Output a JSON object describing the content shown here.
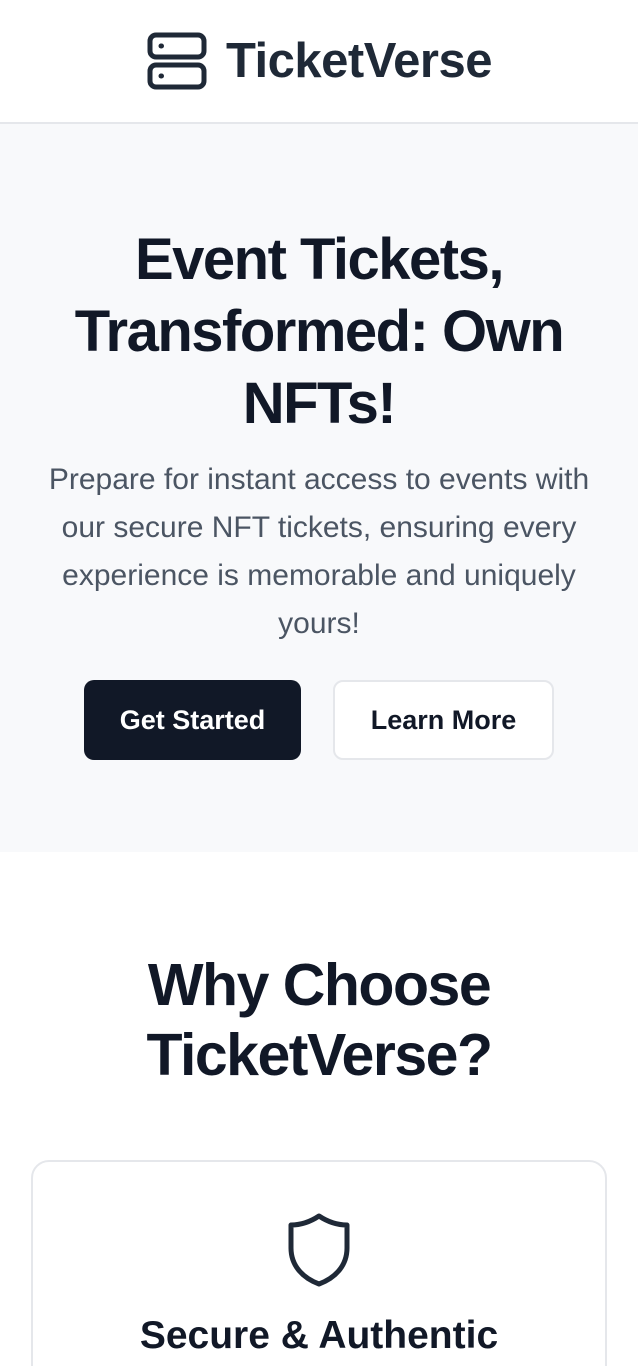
{
  "header": {
    "brand": "TicketVerse",
    "logo_icon": "server-stack-icon"
  },
  "hero": {
    "title": "Event Tickets, Transformed: Own NFTs!",
    "subtitle": "Prepare for instant access to events with our secure NFT tickets, ensuring every experience is memorable and uniquely yours!",
    "primary_button": "Get Started",
    "secondary_button": "Learn More"
  },
  "features": {
    "title": "Why Choose TicketVerse?",
    "cards": [
      {
        "icon": "shield-icon",
        "title": "Secure & Authentic"
      }
    ]
  },
  "colors": {
    "primary": "#111827",
    "hero_bg": "#f8f9fb",
    "muted_text": "#4b5563",
    "border": "#e5e7eb"
  }
}
